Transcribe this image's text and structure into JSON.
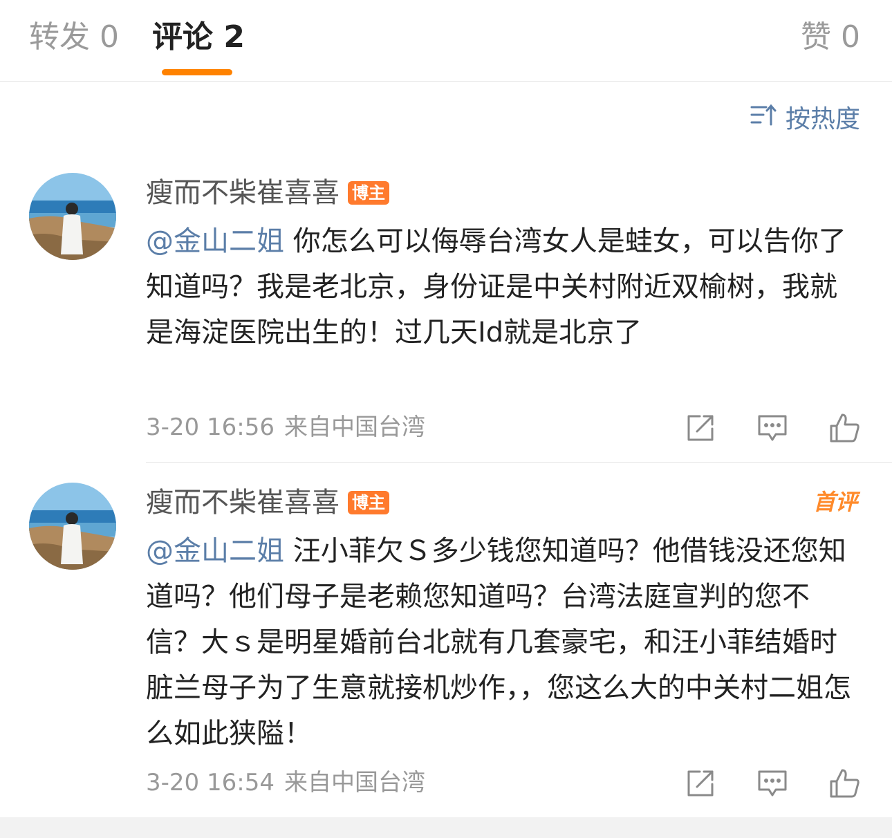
{
  "tabs": {
    "repost": "转发 0",
    "comment": "评论 2",
    "like": "赞 0"
  },
  "sort": {
    "label": "按热度",
    "icon": "sort-icon"
  },
  "comments": [
    {
      "author": "瘦而不柴崔喜喜",
      "badge": "博主",
      "mention": "@金山二姐",
      "text": "你怎么可以侮辱台湾女人是蛙女，可以告你了知道吗？我是老北京，身份证是中关村附近双榆树，我就是海淀医院出生的！过几天Id就是北京了",
      "time": "3-20 16:56",
      "location": "来自中国台湾"
    },
    {
      "author": "瘦而不柴崔喜喜",
      "badge": "博主",
      "first_badge": "首评",
      "mention": "@金山二姐",
      "text": "汪小菲欠Ｓ多少钱您知道吗？他借钱没还您知道吗？他们母子是老赖您知道吗？台湾法庭宣判的您不信？大ｓ是明星婚前台北就有几套豪宅，和汪小菲结婚时脏兰母子为了生意就接机炒作，，您这么大的中关村二姐怎么如此狭隘！",
      "time": "3-20 16:54",
      "location": "来自中国台湾"
    }
  ],
  "colors": {
    "accent": "#ff8200",
    "link": "#5b7ea8",
    "badge": "#ff7a2d"
  }
}
